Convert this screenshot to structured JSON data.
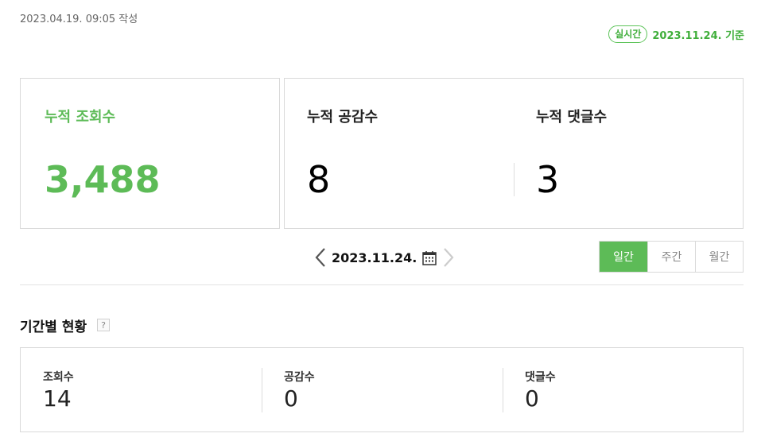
{
  "header": {
    "written_date": "2023.04.19. 09:05 작성",
    "realtime_badge": "실시간",
    "realtime_date": "2023.11.24. 기준"
  },
  "cumulative": {
    "views_label": "누적 조회수",
    "views_value": "3,488",
    "likes_label": "누적 공감수",
    "likes_value": "8",
    "comments_label": "누적 댓글수",
    "comments_value": "3"
  },
  "date_nav": {
    "date": "2023.11.24.",
    "prev_icon": "chevron-left-icon",
    "next_icon": "chevron-right-icon",
    "calendar_icon": "calendar-icon"
  },
  "period_tabs": [
    {
      "label": "일간",
      "active": true
    },
    {
      "label": "주간",
      "active": false
    },
    {
      "label": "월간",
      "active": false
    }
  ],
  "section": {
    "title": "기간별 현황",
    "help": "?"
  },
  "summary": [
    {
      "label": "조회수",
      "value": "14"
    },
    {
      "label": "공감수",
      "value": "0"
    },
    {
      "label": "댓글수",
      "value": "0"
    }
  ],
  "colors": {
    "accent": "#5dbb57",
    "border": "#d9d9d9"
  }
}
